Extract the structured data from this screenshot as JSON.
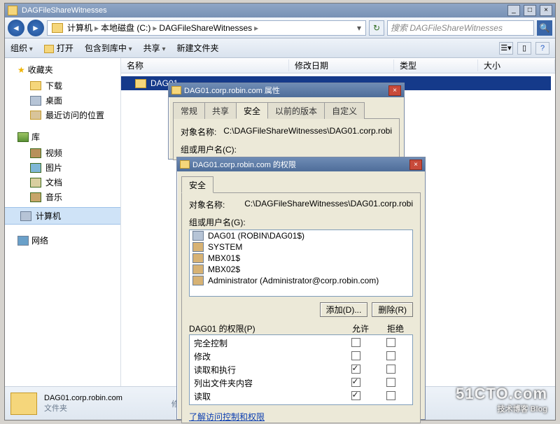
{
  "window": {
    "title": "DAGFileShareWitnesses"
  },
  "nav": {
    "crumbs": [
      "计算机",
      "本地磁盘 (C:)",
      "DAGFileShareWitnesses"
    ],
    "search_placeholder": "搜索 DAGFileShareWitnesses"
  },
  "toolbar": {
    "organize": "组织",
    "open": "打开",
    "include": "包含到库中",
    "share": "共享",
    "newfolder": "新建文件夹"
  },
  "navpane": {
    "favorites": "收藏夹",
    "fav_items": [
      "下载",
      "桌面",
      "最近访问的位置"
    ],
    "libs": "库",
    "lib_items": [
      "视频",
      "图片",
      "文档",
      "音乐"
    ],
    "computer": "计算机",
    "network": "网络"
  },
  "columns": {
    "name": "名称",
    "date": "修改日期",
    "type": "类型",
    "size": "大小"
  },
  "rows": [
    {
      "name": "DAG01."
    }
  ],
  "status": {
    "name": "DAG01.corp.robin.com",
    "sub1": "文件夹",
    "sub2": "修改"
  },
  "dlg1": {
    "title": "DAG01.corp.robin.com 属性",
    "tabs": [
      "常规",
      "共享",
      "安全",
      "以前的版本",
      "自定义"
    ],
    "obj_label": "对象名称:",
    "obj_value": "C:\\DAGFileShareWitnesses\\DAG01.corp.robi",
    "grp_label_cut": "组或用户名(C):"
  },
  "dlg2": {
    "title": "DAG01.corp.robin.com 的权限",
    "tab": "安全",
    "obj_label": "对象名称:",
    "obj_value": "C:\\DAGFileShareWitnesses\\DAG01.corp.robi",
    "grp_label": "组或用户名(G):",
    "users": [
      "DAG01 (ROBIN\\DAG01$)",
      "SYSTEM",
      "MBX01$",
      "MBX02$",
      "Administrator (Administrator@corp.robin.com)"
    ],
    "btn_add": "添加(D)...",
    "btn_remove": "删除(R)",
    "perm_header": "DAG01 的权限(P)",
    "col_allow": "允许",
    "col_deny": "拒绝",
    "perms": [
      {
        "label": "完全控制",
        "allow": false,
        "deny": false
      },
      {
        "label": "修改",
        "allow": false,
        "deny": false
      },
      {
        "label": "读取和执行",
        "allow": true,
        "deny": false
      },
      {
        "label": "列出文件夹内容",
        "allow": true,
        "deny": false
      },
      {
        "label": "读取",
        "allow": true,
        "deny": false
      }
    ],
    "learn_link": "了解访问控制和权限"
  },
  "watermark": {
    "a": "51CTO.com",
    "b": "技术博客        Blog"
  }
}
